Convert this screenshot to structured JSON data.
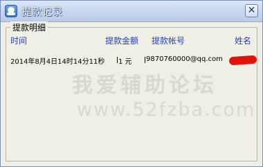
{
  "window": {
    "title": "提款记录",
    "close_glyph": "✕"
  },
  "group": {
    "legend": "提款明细"
  },
  "columns": {
    "time": "时间",
    "amount": "提款金额",
    "account": "提款帐号",
    "name": "姓名"
  },
  "rows": [
    {
      "time": "2014年8月4日14时14分11秒",
      "amount": "1 元",
      "account": "9870760000@qq.com",
      "name_redacted": true
    }
  ],
  "watermark": {
    "text": "我爱辅助论坛",
    "url": "www.52fzba.com"
  },
  "colors": {
    "header_text": "#1f3fd0",
    "redaction": "#e0140a",
    "window_bg": "#f0efe6"
  },
  "icons": {
    "app": "app-avatar-icon",
    "close": "close-icon"
  }
}
